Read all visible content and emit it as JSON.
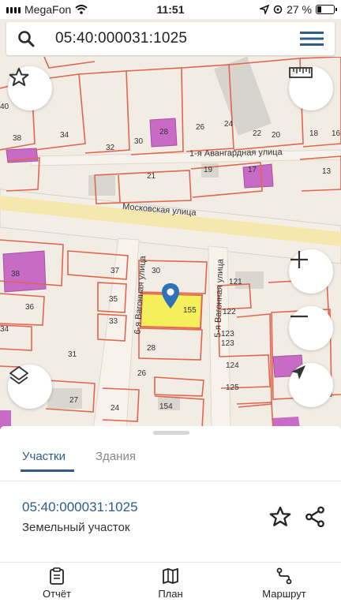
{
  "status_bar": {
    "carrier": "MegaFon",
    "time": "11:51",
    "battery": "27 %"
  },
  "search": {
    "query": "05:40:000031:1025"
  },
  "map": {
    "streets": [
      "1-я Авангардная улица",
      "Московская улица",
      "6-я Вагонная улица",
      "5-я Вагонная улица"
    ],
    "labels": [
      "40",
      "38",
      "34",
      "32",
      "30",
      "28",
      "26",
      "24",
      "22",
      "20",
      "18",
      "16",
      "19",
      "17",
      "13",
      "21",
      "38",
      "37",
      "30",
      "121",
      "36",
      "35",
      "33",
      "155",
      "122",
      "123",
      "123",
      "34",
      "31",
      "28",
      "124",
      "26",
      "125",
      "27",
      "154",
      "24"
    ]
  },
  "sheet": {
    "tabs": [
      "Участки",
      "Здания"
    ],
    "parcel_number": "05:40:000031:1025",
    "parcel_type": "Земельный участок"
  },
  "nav": {
    "report": "Отчёт",
    "plan": "План",
    "route": "Маршрут"
  },
  "colors": {
    "accent": "#2e5d8c",
    "parcel_border": "#e0664f",
    "highlight": "#f5ef5b",
    "building_purple": "#c86bc6",
    "road": "#f6e9b5"
  }
}
